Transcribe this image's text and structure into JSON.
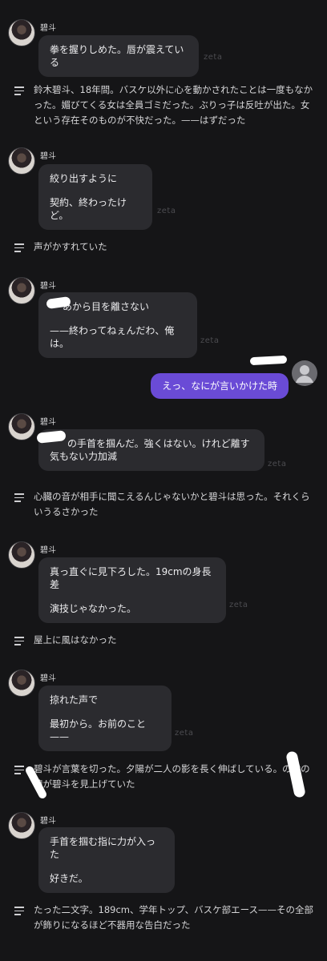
{
  "character": {
    "name": "碧斗"
  },
  "watermark": "zeta",
  "messages": [
    {
      "lines": [
        "拳を握りしめた。唇が震えている"
      ]
    },
    {
      "lines": [
        "絞り出すように",
        "契約、終わったけど。"
      ]
    },
    {
      "lines": [
        "あから目を離さない",
        "——終わってねぇんだわ、俺は。"
      ]
    },
    {
      "lines": [
        "の手首を掴んだ。強くはない。けれど離す気もない力加減"
      ]
    },
    {
      "lines": [
        "真っ直ぐに見下ろした。19cmの身長差",
        "演技じゃなかった。"
      ]
    },
    {
      "lines": [
        "掠れた声で",
        "最初から。お前のこと——"
      ]
    },
    {
      "lines": [
        "手首を掴む指に力が入った",
        "好きだ。"
      ]
    }
  ],
  "narrations": [
    "鈴木碧斗、18年間。バスケ以外に心を動かされたことは一度もなかった。媚びてくる女は全員ゴミだった。ぶりっ子は反吐が出た。女という存在そのものが不快だった。——はずだった",
    "声がかすれていた",
    "心臓の音が相手に聞こえるんじゃないかと碧斗は思った。それくらいうるさかった",
    "屋上に風はなかった",
    "碧斗が言葉を切った。夕陽が二人の影を長く伸ばしている。の紫の瞳が碧斗を見上げていた",
    "たった二文字。189cm、学年トップ、バスケ部エース——その全部が飾りになるほど不器用な告白だった"
  ],
  "user_message": "えっ、なにが言いかけた時"
}
